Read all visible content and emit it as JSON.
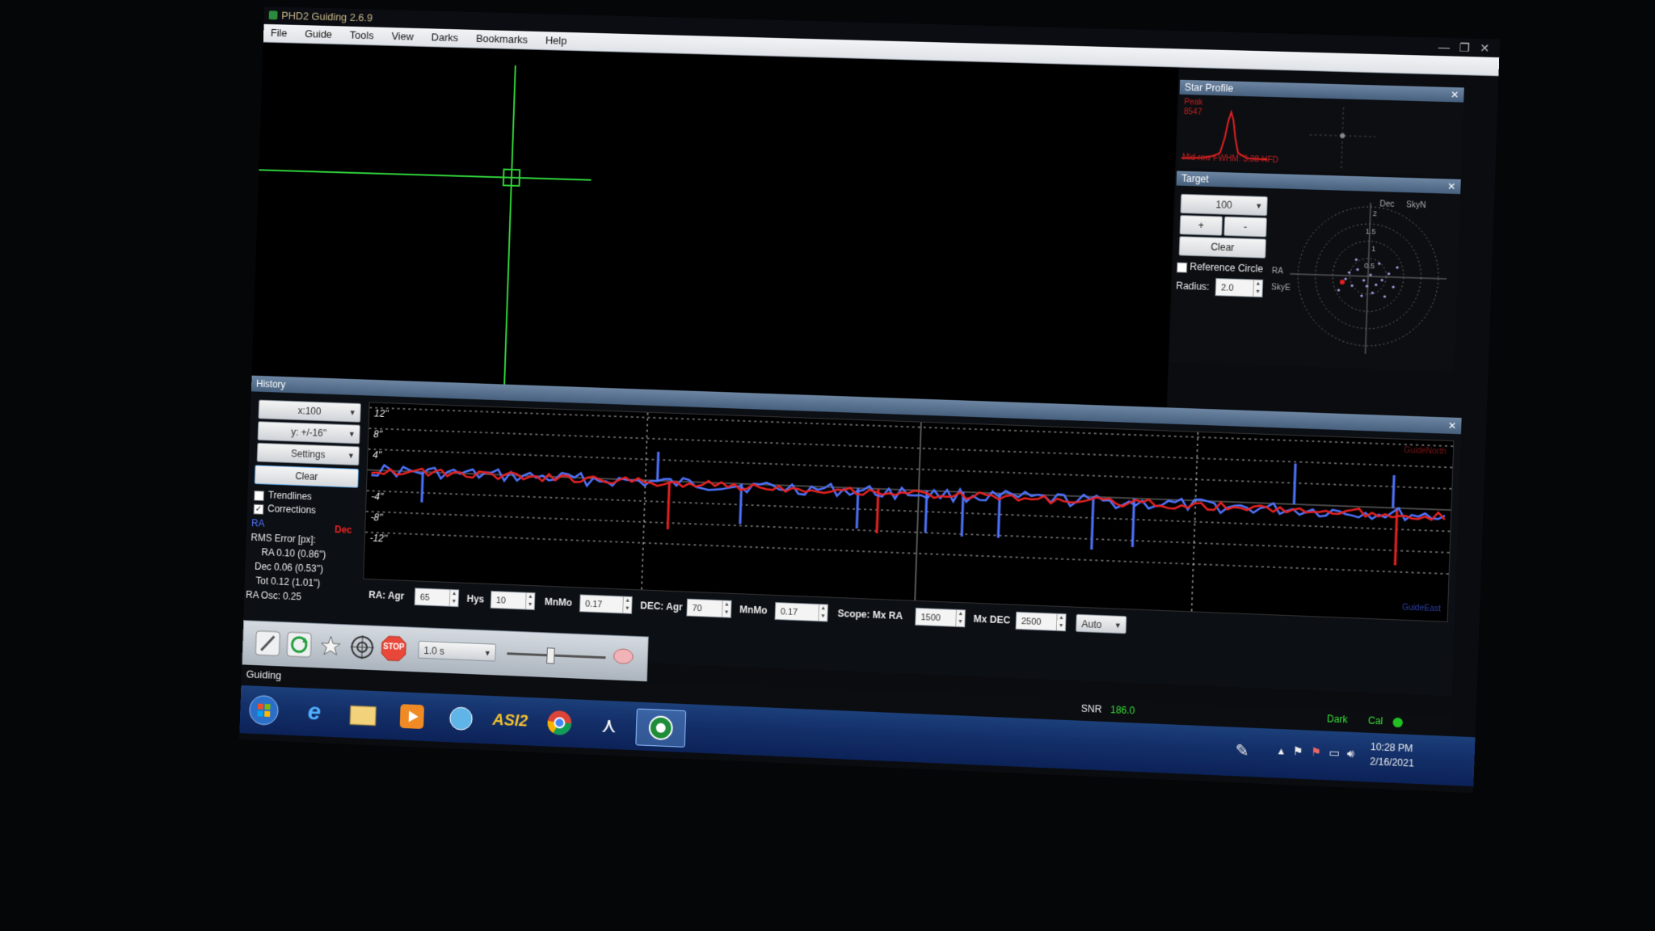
{
  "window": {
    "title": "PHD2 Guiding 2.6.9",
    "minimize": "—",
    "restore": "❐",
    "close": "✕"
  },
  "menu": [
    "File",
    "Guide",
    "Tools",
    "View",
    "Darks",
    "Bookmarks",
    "Help"
  ],
  "star_profile": {
    "title": "Star Profile",
    "peak_label": "Peak",
    "peak_value": "8547",
    "fwhm_text": "Mid row FWHM: 3.38 HFD"
  },
  "target": {
    "title": "Target",
    "zoom": "100",
    "plus": "+",
    "minus": "-",
    "clear": "Clear",
    "reference_circle": "Reference Circle",
    "radius_label": "Radius:",
    "radius_value": "2.0",
    "dec": "Dec",
    "skyn": "SkyN",
    "ra": "RA",
    "skye": "SkyE",
    "rings": [
      "2",
      "1.5",
      "1",
      "0.5"
    ]
  },
  "history": {
    "title": "History",
    "x_scale": "x:100",
    "y_scale": "y: +/-16''",
    "settings": "Settings",
    "clear": "Clear",
    "trendlines": "Trendlines",
    "corrections": "Corrections",
    "ra_legend": "RA",
    "dec_legend": "Dec",
    "rms_title": "RMS Error [px]:",
    "rms_ra": "RA 0.10 (0.86'')",
    "rms_dec": "Dec 0.06 (0.53'')",
    "rms_tot": "Tot 0.12 (1.01'')",
    "ra_osc": "RA Osc: 0.25",
    "y_ticks": [
      "12''",
      "8''",
      "4''",
      "-4''",
      "-8''",
      "-12''"
    ],
    "guide_north": "GuideNorth",
    "guide_east": "GuideEast"
  },
  "params": {
    "ra_agr_label": "RA: Agr",
    "ra_agr": "65",
    "hys_label": "Hys",
    "hys": "10",
    "mnmo_label": "MnMo",
    "ra_mnmo": "0.17",
    "dec_agr_label": "DEC: Agr",
    "dec_agr": "70",
    "dec_mnmo": "0.17",
    "scope_label": "Scope: Mx RA",
    "mx_ra": "1500",
    "mx_dec_label": "Mx DEC",
    "mx_dec": "2500",
    "dec_mode": "Auto"
  },
  "toolbar": {
    "exposure": "1.0 s",
    "stop": "STOP"
  },
  "status": {
    "text": "Guiding",
    "snr_label": "SNR",
    "snr_value": "186.0",
    "dark": "Dark",
    "cal": "Cal"
  },
  "taskbar": {
    "asi": "ASI2",
    "time": "10:28 PM",
    "date": "2/16/2021"
  },
  "colors": {
    "ra": "#4f74ff",
    "dec": "#e82222",
    "crosshair": "#2fd23a",
    "snr": "#38e038"
  }
}
